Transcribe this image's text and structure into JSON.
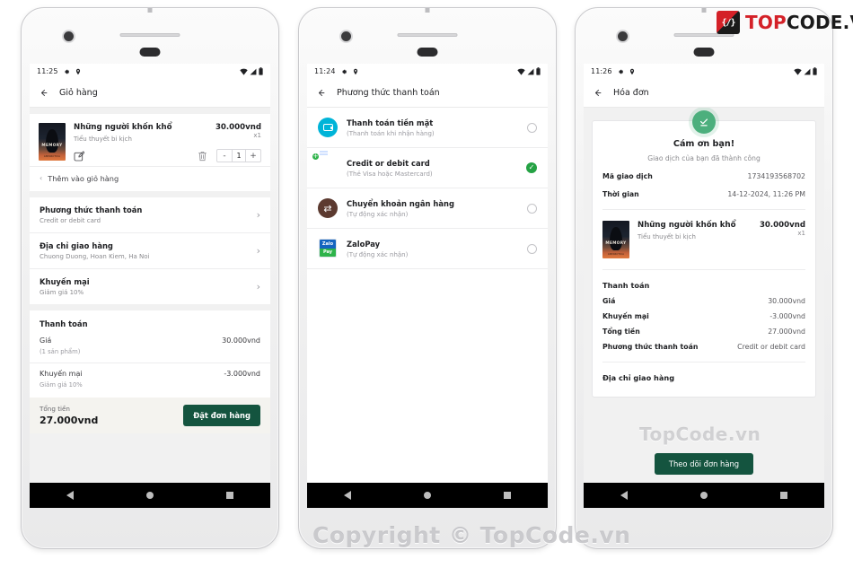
{
  "brand": {
    "mark": "code-brackets-icon",
    "name_red": "TOP",
    "name_dark": "CODE.VN"
  },
  "watermark": {
    "main": "Copyright © TopCode.vn",
    "small": "TopCode.vn"
  },
  "nav_icons": {
    "back": "back-triangle-icon",
    "home": "home-circle-icon",
    "recents": "recents-square-icon"
  },
  "screens": [
    {
      "id": "cart",
      "status": {
        "time": "11:25",
        "icons": [
          "gear-icon",
          "location-pin-icon"
        ],
        "right": [
          "wifi-icon",
          "signal-icon",
          "battery-icon"
        ]
      },
      "appbar": {
        "back": "back-arrow-icon",
        "title": "Giỏ hàng"
      },
      "item": {
        "title": "Những người khốn khổ",
        "price": "30.000vnd",
        "subtitle": "Tiểu thuyết bi kịch",
        "qty_label": "x1",
        "cover_title": "MEMORY",
        "cover_author": "ANTARCTICA",
        "edit_icon": "edit-pencil-icon",
        "delete_icon": "trash-icon",
        "minus": "-",
        "value": "1",
        "plus": "+"
      },
      "add_more": "Thêm vào giỏ hàng",
      "options": [
        {
          "title": "Phương thức thanh toán",
          "sub": "Credit or debit card"
        },
        {
          "title": "Địa chỉ giao hàng",
          "sub": "Chuong Duong, Hoan Kiem, Ha Noi"
        },
        {
          "title": "Khuyến mại",
          "sub": "Giảm giá 10%"
        }
      ],
      "payment": {
        "heading": "Thanh toán",
        "lines": [
          {
            "label": "Giá",
            "value": "30.000vnd",
            "sub": "(1 sản phẩm)"
          },
          {
            "label": "Khuyến mại",
            "value": "-3.000vnd",
            "sub": "Giảm giá 10%"
          }
        ],
        "total_label": "Tổng tiền",
        "total_value": "27.000vnd",
        "cta": "Đặt đơn hàng"
      }
    },
    {
      "id": "payment-methods",
      "status": {
        "time": "11:24"
      },
      "appbar": {
        "title": "Phương thức thanh toán"
      },
      "methods": [
        {
          "icon": "wallet-icon",
          "title": "Thanh toán tiền mặt",
          "sub": "(Thanh toán khi nhận hàng)",
          "selected": false
        },
        {
          "icon": "credit-card-icon",
          "title": "Credit or debit card",
          "sub": "(Thẻ Visa hoặc Mastercard)",
          "selected": true
        },
        {
          "icon": "bank-transfer-icon",
          "title": "Chuyển khoản ngân hàng",
          "sub": "(Tự động xác nhận)",
          "selected": false
        },
        {
          "icon": "zalopay-icon",
          "title": "ZaloPay",
          "sub": "(Tự động xác nhận)",
          "selected": false,
          "logo_top": "Zalo",
          "logo_bottom": "Pay"
        }
      ]
    },
    {
      "id": "invoice",
      "status": {
        "time": "11:26"
      },
      "appbar": {
        "title": "Hóa đơn"
      },
      "badge_icon": "check-circle-icon",
      "thanks": "Cám ơn bạn!",
      "thanks_sub": "Giao dịch của bạn đã thành công",
      "meta": [
        {
          "key": "Mã giao dịch",
          "value": "1734193568702"
        },
        {
          "key": "Thời gian",
          "value": "14-12-2024, 11:26 PM"
        }
      ],
      "item": {
        "title": "Những người khốn khổ",
        "price": "30.000vnd",
        "subtitle": "Tiểu thuyết bi kịch",
        "qty_label": "x1"
      },
      "payment_heading": "Thanh toán",
      "payment_lines": [
        {
          "label": "Giá",
          "value": "30.000vnd"
        },
        {
          "label": "Khuyến mại",
          "value": "-3.000vnd"
        },
        {
          "label": "Tổng tiền",
          "value": "27.000vnd"
        },
        {
          "label": "Phương thức thanh toán",
          "value": "Credit or debit card"
        }
      ],
      "address_heading": "Địa chỉ giao hàng",
      "cta": "Theo dõi đơn hàng"
    }
  ],
  "colors": {
    "primary_green": "#14543f",
    "success": "#25a244",
    "badge_green": "#4caf7d",
    "brand_red": "#d42128"
  }
}
